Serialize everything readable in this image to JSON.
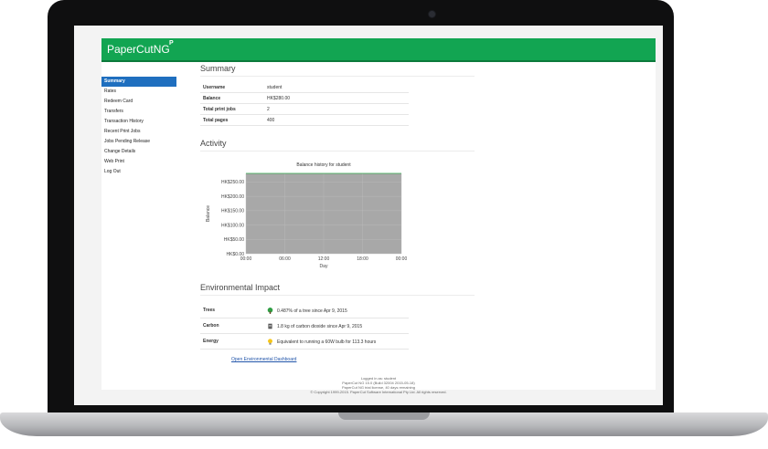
{
  "app": {
    "brand": "PaperCutNG",
    "brand_mark": "P"
  },
  "sidebar": {
    "items": [
      {
        "label": "Summary",
        "active": true
      },
      {
        "label": "Rates"
      },
      {
        "label": "Redeem Card"
      },
      {
        "label": "Transfers"
      },
      {
        "label": "Transaction History"
      },
      {
        "label": "Recent Print Jobs"
      },
      {
        "label": "Jobs Pending Release"
      },
      {
        "label": "Change Details"
      },
      {
        "label": "Web Print"
      },
      {
        "label": "Log Out"
      }
    ]
  },
  "summary": {
    "title": "Summary",
    "rows": [
      {
        "key": "Username",
        "value": "student"
      },
      {
        "key": "Balance",
        "value": "HK$280.00"
      },
      {
        "key": "Total print jobs",
        "value": "2"
      },
      {
        "key": "Total pages",
        "value": "400"
      }
    ]
  },
  "activity": {
    "title": "Activity"
  },
  "chart_data": {
    "type": "line",
    "title": "Balance history for student",
    "xlabel": "Day",
    "ylabel": "Balance",
    "x": [
      "00:00",
      "06:00",
      "12:00",
      "18:00",
      "00:00"
    ],
    "yticks": [
      "HK$0.00",
      "HK$50.00",
      "HK$100.00",
      "HK$150.00",
      "HK$200.00",
      "HK$250.00"
    ],
    "ylim": [
      0,
      280
    ],
    "series": [
      {
        "values": [
          280,
          280,
          280,
          280,
          280
        ]
      }
    ],
    "grid": true,
    "colors": {
      "plot_bg": "#a8a8a8",
      "line": "#2ea84a"
    }
  },
  "environment": {
    "title": "Environmental Impact",
    "rows": [
      {
        "key": "Trees",
        "value": "0.487% of a tree since Apr 9, 2015",
        "icon": "tree-icon"
      },
      {
        "key": "Carbon",
        "value": "1.8 kg of carbon dioxide since Apr 9, 2015",
        "icon": "carbon-icon"
      },
      {
        "key": "Energy",
        "value": "Equivalent to running a 60W bulb for 113.3 hours",
        "icon": "bulb-icon"
      }
    ],
    "link": "Open Environmental Dashboard"
  },
  "footer": {
    "lines": [
      "Logged in as: student",
      "PaperCut NG 15.0 (Build 32004 2015-05-18)",
      "PaperCut NG trial license, 40 days remaining",
      "© Copyright 1999-2015. PaperCut Software International Pty Ltd. All rights reserved."
    ]
  },
  "colors": {
    "header": "#12a552",
    "active_nav": "#1f6fbf"
  }
}
